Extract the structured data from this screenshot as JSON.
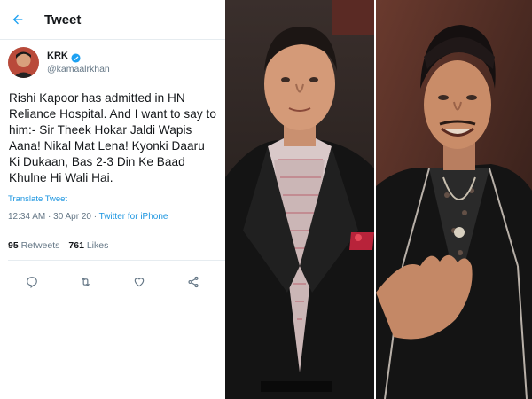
{
  "header": {
    "title": "Tweet",
    "back_icon": "arrow-left-icon"
  },
  "user": {
    "name": "KRK",
    "handle": "@kamaalrkhan",
    "verified_icon": "verified-badge-icon"
  },
  "tweet": {
    "text": "Rishi Kapoor has admitted in HN Reliance Hospital. And I want to say to him:- Sir Theek Hokar Jaldi Wapis Aana! Nikal Mat Lena! Kyonki Daaru Ki Dukaan, Bas 2-3 Din Ke Baad Khulne Hi Wali Hai.",
    "translate_label": "Translate Tweet",
    "timestamp": "12:34 AM · 30 Apr 20 · ",
    "source": "Twitter for iPhone"
  },
  "stats": {
    "retweets_count": "95",
    "retweets_label": "Retweets",
    "likes_count": "761",
    "likes_label": "Likes"
  },
  "actions": [
    "reply-icon",
    "retweet-icon",
    "like-icon",
    "share-icon"
  ],
  "colors": {
    "accent": "#1da1f2",
    "link": "#1b95e0",
    "text": "#14171a",
    "muted": "#657786"
  }
}
